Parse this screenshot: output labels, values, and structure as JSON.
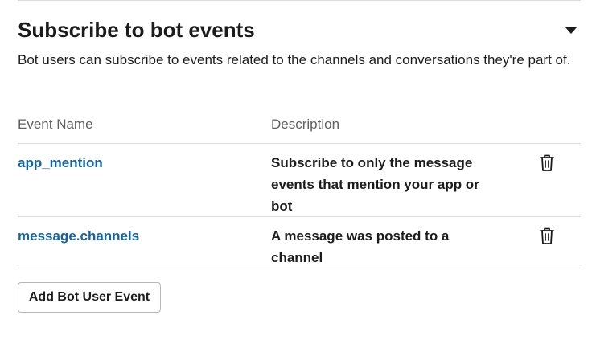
{
  "section": {
    "title": "Subscribe to bot events",
    "description": "Bot users can subscribe to events related to the channels and conversations they're part of.",
    "toggle_icon": "caret-down-icon"
  },
  "table": {
    "columns": {
      "event_name": "Event Name",
      "description": "Description"
    },
    "rows": [
      {
        "event_name": "app_mention",
        "description": "Subscribe to only the message events that mention your app or bot",
        "action_icon": "trash-icon"
      },
      {
        "event_name": "message.channels",
        "description": "A message was posted to a channel",
        "action_icon": "trash-icon"
      }
    ]
  },
  "actions": {
    "add_label": "Add Bot User Event"
  },
  "colors": {
    "link": "#1264a3",
    "text": "#1d1c1d",
    "muted": "#616061",
    "divider": "#dddddd"
  }
}
